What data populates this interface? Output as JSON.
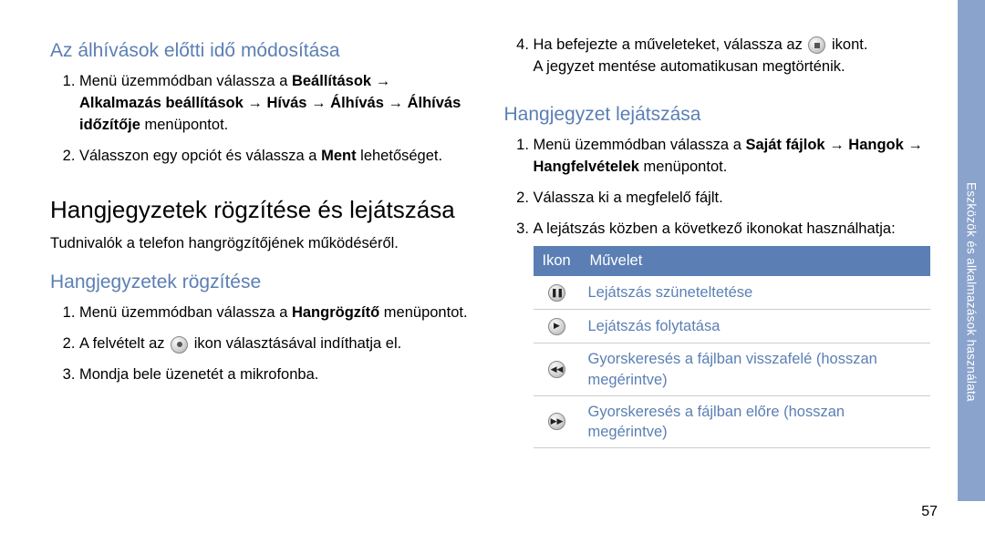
{
  "left": {
    "sec1_title": "Az álhívások előtti idő módosítása",
    "sec1_item1_a": "Menü üzemmódban válassza a ",
    "sec1_item1_b": "Beállítások",
    "sec1_item1_c": "Alkalmazás beállítások",
    "sec1_item1_d": "Hívás",
    "sec1_item1_e": "Álhívás",
    "sec1_item1_f": "Álhívás időzítője",
    "sec1_item1_g": " menüpontot.",
    "sec1_item2_a": "Válasszon egy opciót és válassza a ",
    "sec1_item2_b": "Ment",
    "sec1_item2_c": " lehetőséget.",
    "main_heading": "Hangjegyzetek rögzítése és lejátszása",
    "intro": "Tudnivalók a telefon hangrögzítőjének működéséről.",
    "sec2_title": "Hangjegyzetek rögzítése",
    "sec2_item1_a": "Menü üzemmódban válassza a ",
    "sec2_item1_b": "Hangrögzítő",
    "sec2_item1_c": " menüpontot.",
    "sec2_item2_a": "A felvételt az ",
    "sec2_item2_b": " ikon választásával indíthatja el.",
    "sec2_item3": "Mondja bele üzenetét a mikrofonba."
  },
  "right": {
    "cont_item4_a": "Ha befejezte a műveleteket, válassza az ",
    "cont_item4_b": " ikont.",
    "cont_note": "A jegyzet mentése automatikusan megtörténik.",
    "sec3_title": "Hangjegyzet lejátszása",
    "sec3_item1_a": "Menü üzemmódban válassza a ",
    "sec3_item1_b": "Saját fájlok",
    "sec3_item1_c": "Hangok",
    "sec3_item1_d": "Hangfelvételek",
    "sec3_item1_e": " menüpontot.",
    "sec3_item2": "Válassza ki a megfelelő fájlt.",
    "sec3_item3": "A lejátszás közben a következő ikonokat használhatja:",
    "table": {
      "h1": "Ikon",
      "h2": "Művelet",
      "r1": "Lejátszás szüneteltetése",
      "r2": "Lejátszás folytatása",
      "r3": "Gyorskeresés a fájlban visszafelé (hosszan megérintve)",
      "r4": "Gyorskeresés a fájlban előre (hosszan megérintve)"
    }
  },
  "sidebar": "Eszközök és alkalmazások használata",
  "pagenum": "57",
  "arrow": "→"
}
